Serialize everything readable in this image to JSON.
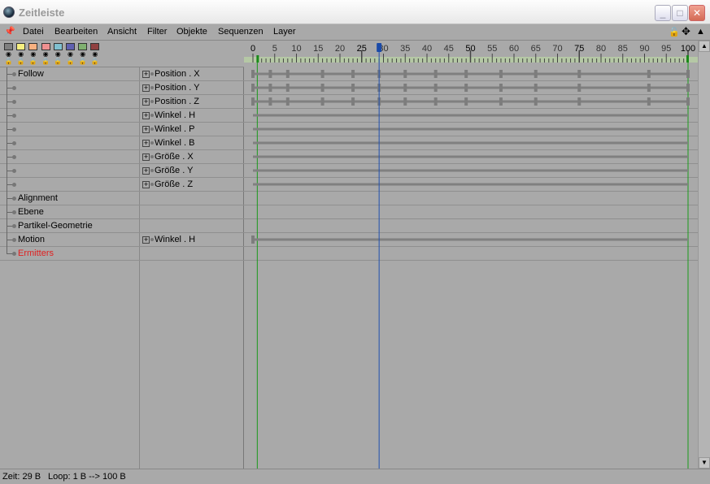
{
  "window": {
    "title": "Zeitleiste",
    "controls": [
      "minimize",
      "maximize",
      "close"
    ]
  },
  "menu": {
    "items": [
      "Datei",
      "Bearbeiten",
      "Ansicht",
      "Filter",
      "Objekte",
      "Sequenzen",
      "Layer"
    ],
    "right_icons": [
      "lock-icon",
      "move-icon",
      "warning-icon"
    ]
  },
  "layers": {
    "colors": [
      "#808080",
      "#f8f080",
      "#f8b080",
      "#f09090",
      "#80c0d0",
      "#6060b0",
      "#80b070",
      "#904040"
    ]
  },
  "ruler": {
    "start": 0,
    "end": 100,
    "step": 5,
    "bold": [
      25,
      50,
      75,
      100
    ],
    "current_frame": 29,
    "preview_start": 1,
    "preview_end": 100
  },
  "tracks": [
    {
      "object": "Follow",
      "track": "Position . X",
      "keys": [
        0,
        4,
        8,
        16,
        23,
        29,
        35,
        42,
        49,
        57,
        65,
        75,
        91,
        100
      ]
    },
    {
      "object": "",
      "track": "Position . Y",
      "keys": [
        0,
        4,
        8,
        16,
        23,
        29,
        35,
        42,
        49,
        57,
        65,
        75,
        91,
        100
      ]
    },
    {
      "object": "",
      "track": "Position . Z",
      "keys": [
        0,
        4,
        8,
        16,
        23,
        29,
        35,
        42,
        49,
        57,
        65,
        75,
        91,
        100
      ]
    },
    {
      "object": "",
      "track": "Winkel . H",
      "keys": []
    },
    {
      "object": "",
      "track": "Winkel . P",
      "keys": []
    },
    {
      "object": "",
      "track": "Winkel . B",
      "keys": []
    },
    {
      "object": "",
      "track": "Größe . X",
      "keys": []
    },
    {
      "object": "",
      "track": "Größe . Y",
      "keys": []
    },
    {
      "object": "",
      "track": "Größe . Z",
      "keys": []
    },
    {
      "object": "Alignment",
      "track": "",
      "keys": null
    },
    {
      "object": "Ebene",
      "track": "",
      "keys": null
    },
    {
      "object": "Partikel-Geometrie",
      "track": "",
      "keys": null
    },
    {
      "object": "Motion",
      "track": "Winkel . H",
      "keys": [
        0
      ]
    },
    {
      "object": "Ermitters",
      "track": "",
      "keys": null,
      "color": "#e02020"
    }
  ],
  "status": {
    "time": "Zeit: 29 B",
    "loop": "Loop: 1 B --> 100 B"
  }
}
